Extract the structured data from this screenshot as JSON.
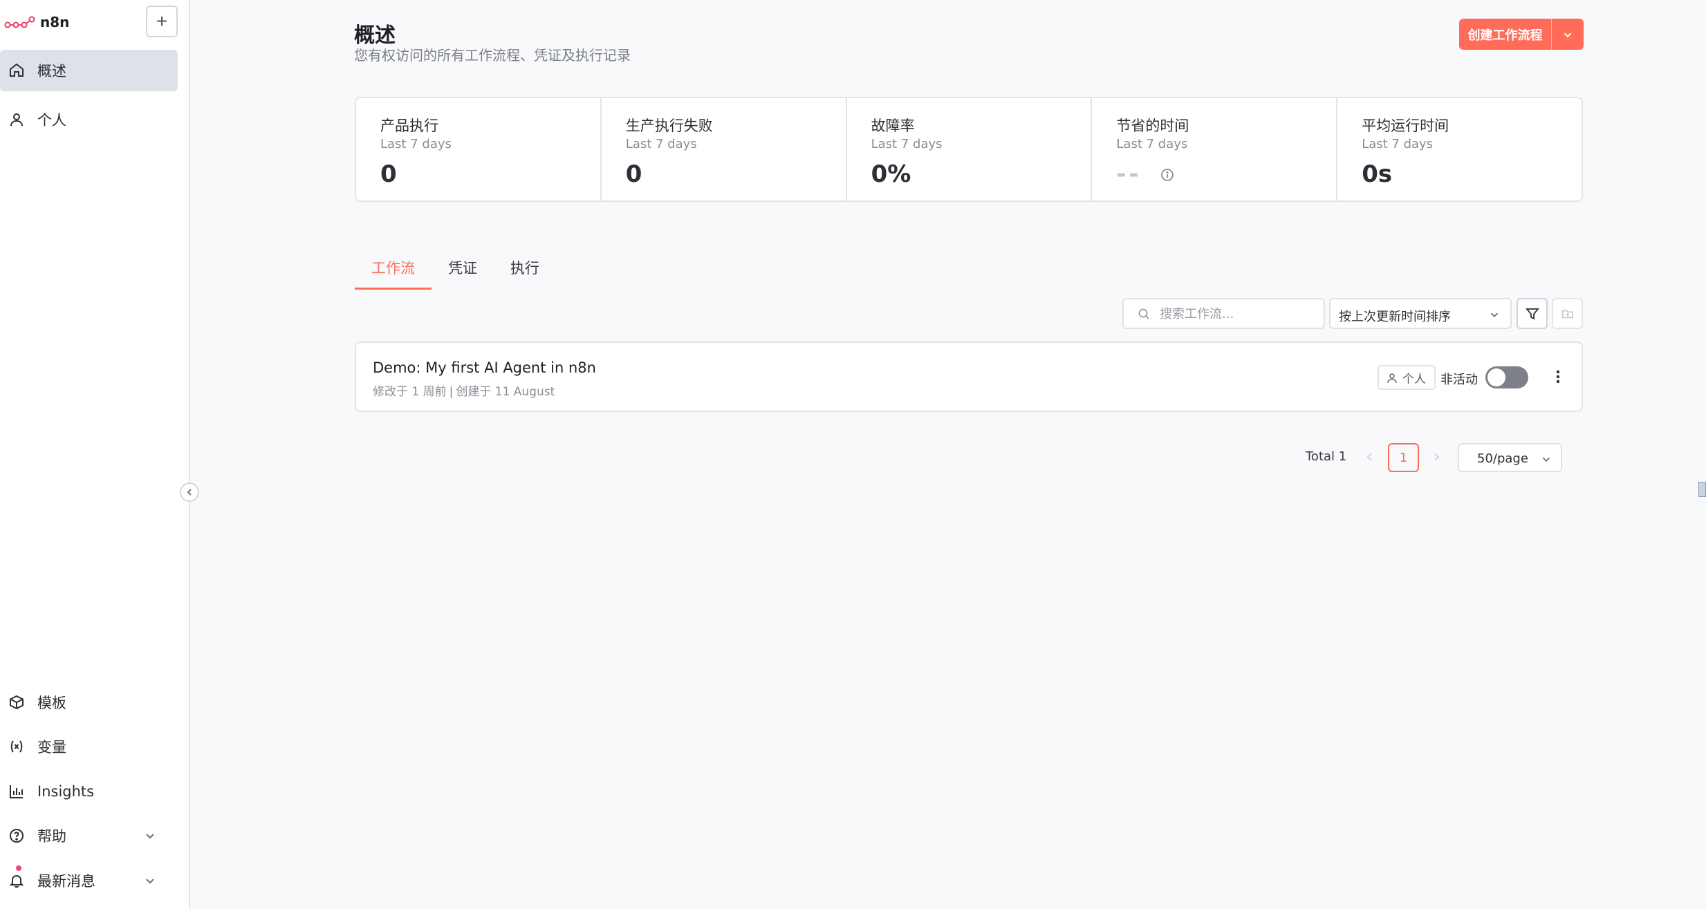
{
  "app": {
    "logo_text": "n8n",
    "new_button": "+"
  },
  "sidebar": {
    "top_items": [
      {
        "label": "概述",
        "icon": "home-icon",
        "active": true
      },
      {
        "label": "个人",
        "icon": "user-icon",
        "active": false
      }
    ],
    "bottom_items": [
      {
        "label": "模板",
        "icon": "box-icon"
      },
      {
        "label": "变量",
        "icon": "variable-icon"
      },
      {
        "label": "Insights",
        "icon": "bar-chart-icon"
      },
      {
        "label": "帮助",
        "icon": "help-circle-icon"
      },
      {
        "label": "最新消息",
        "icon": "bell-icon"
      }
    ]
  },
  "header": {
    "title": "概述",
    "subtitle": "您有权访问的所有工作流程、凭证及执行记录",
    "create_button": "创建工作流程"
  },
  "stats": [
    {
      "title": "产品执行",
      "period": "Last 7 days",
      "value": "0"
    },
    {
      "title": "生产执行失败",
      "period": "Last 7 days",
      "value": "0"
    },
    {
      "title": "故障率",
      "period": "Last 7 days",
      "value": "0%"
    },
    {
      "title": "节省的时间",
      "period": "Last 7 days",
      "value": "--"
    },
    {
      "title": "平均运行时间",
      "period": "Last 7 days",
      "value": "0s"
    }
  ],
  "tabs": [
    {
      "label": "工作流",
      "active": true
    },
    {
      "label": "凭证",
      "active": false
    },
    {
      "label": "执行",
      "active": false
    }
  ],
  "toolbar": {
    "search_placeholder": "搜索工作流...",
    "search_value": "",
    "sort_value": "按上次更新时间排序"
  },
  "workflows": [
    {
      "name": "Demo: My first AI Agent in n8n",
      "modified": "修改于 1 周前",
      "separator": "|",
      "created": "创建于 11 August",
      "owner": "个人",
      "status": "非活动",
      "active": false
    }
  ],
  "pagination": {
    "total": "Total 1",
    "current_page": "1",
    "per_page": "50/page"
  },
  "colors": {
    "accent": "#ff6d5a",
    "logo": "#ea4b71",
    "active_nav": "#dfe1e8",
    "toggle_off": "#7d7f89"
  }
}
